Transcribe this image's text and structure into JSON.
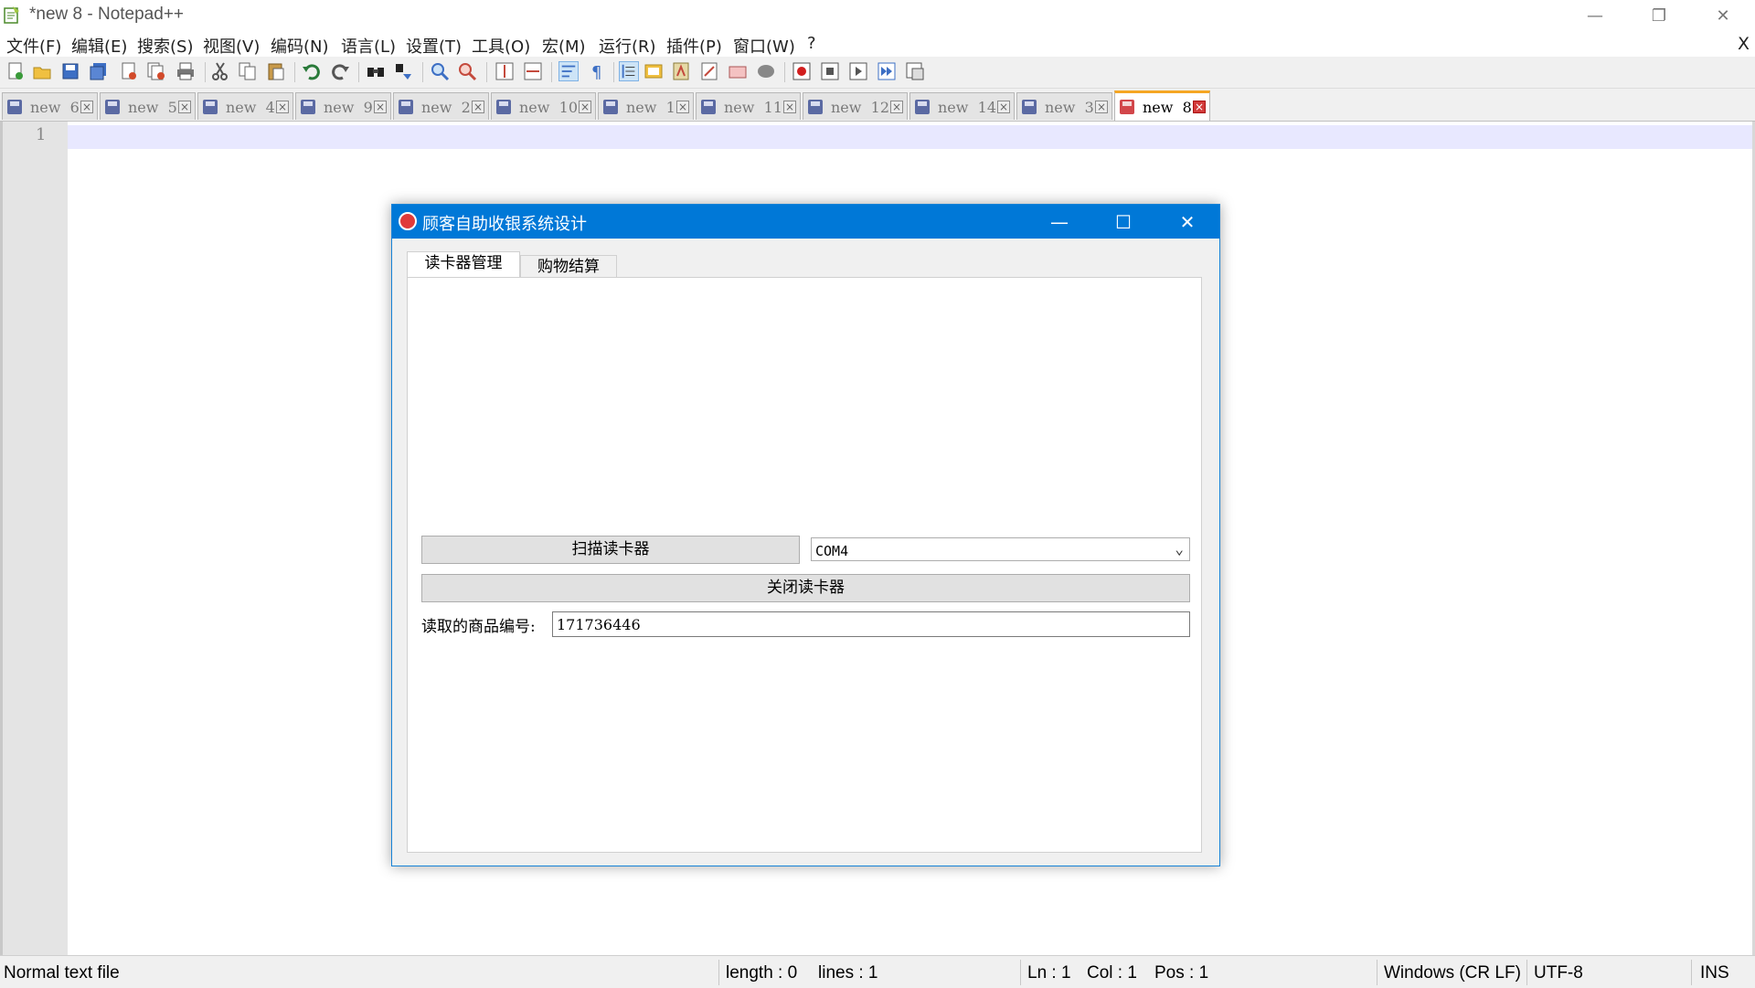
{
  "window": {
    "title": "*new 8 - Notepad++",
    "minimize": "—",
    "restore": "❐",
    "close": "✕"
  },
  "menu": {
    "items": [
      "文件(F)",
      "编辑(E)",
      "搜索(S)",
      "视图(V)",
      "编码(N)",
      "语言(L)",
      "设置(T)",
      "工具(O)",
      "宏(M)",
      "运行(R)",
      "插件(P)",
      "窗口(W)",
      "?"
    ],
    "close_doc": "X"
  },
  "toolbar": {
    "icons": [
      "new-file",
      "open-file",
      "save",
      "save-all",
      "close",
      "close-all",
      "print",
      "cut",
      "copy",
      "paste",
      "undo",
      "redo",
      "find",
      "replace",
      "zoom-in",
      "zoom-out",
      "sync-vertical",
      "sync-horizontal",
      "word-wrap",
      "show-all-chars",
      "indent-guide",
      "doc-map",
      "function-list",
      "folder-workspace",
      "monitoring",
      "record-macro",
      "stop-record",
      "play-macro",
      "run-macro-multiple",
      "save-macro"
    ]
  },
  "tabs": [
    {
      "label": "new  6",
      "active": false
    },
    {
      "label": "new  5",
      "active": false
    },
    {
      "label": "new  4",
      "active": false
    },
    {
      "label": "new  9",
      "active": false
    },
    {
      "label": "new  2",
      "active": false
    },
    {
      "label": "new  10",
      "active": false
    },
    {
      "label": "new  1",
      "active": false
    },
    {
      "label": "new  11",
      "active": false
    },
    {
      "label": "new  12",
      "active": false
    },
    {
      "label": "new  14",
      "active": false
    },
    {
      "label": "new  3",
      "active": false
    },
    {
      "label": "new  8",
      "active": true
    }
  ],
  "editor": {
    "line_number": "1"
  },
  "status": {
    "file_type": "Normal text file",
    "length": "length : 0",
    "lines": "lines : 1",
    "ln": "Ln : 1",
    "col": "Col : 1",
    "pos": "Pos : 1",
    "eol": "Windows (CR LF)",
    "encoding": "UTF-8",
    "mode": "INS"
  },
  "dialog": {
    "title": "顾客自助收银系统设计",
    "minimize": "—",
    "maximize": "☐",
    "close": "✕",
    "tabs": [
      "读卡器管理",
      "购物结算"
    ],
    "scan_button": "扫描读卡器",
    "port_value": "COM4",
    "close_button": "关闭读卡器",
    "product_label": "读取的商品编号:",
    "product_value": "171736446"
  },
  "colors": {
    "dialog_title_bg": "#0078d7",
    "active_tab_accent": "#f5a623",
    "current_line": "#e8e8ff"
  }
}
